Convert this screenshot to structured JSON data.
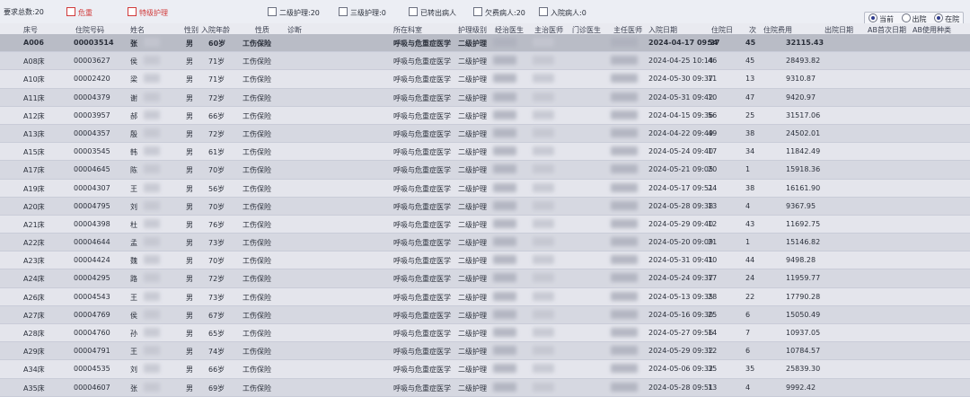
{
  "toolbar": {
    "count_label": "要求总数:20",
    "filter_red1": "危重",
    "filter_red2": "特级护理",
    "chk_level2": "二级护理:20",
    "chk_level3": "三级护理:0",
    "chk_transfer": "已转出病人",
    "chk_arrears": "欠费病人:20",
    "chk_preleave": "入院病人:0",
    "radio_all": "当前",
    "radio_out": "出院",
    "radio_cur": "在院"
  },
  "columns": {
    "bed": "床号",
    "inpatient_no": "住院号码",
    "name": "姓名",
    "sex": "性别",
    "age": "入院年龄",
    "nature": "性质",
    "diag": "诊断",
    "ward": "所在科室",
    "nurse_level": "护理级别",
    "doctor": "经治医生",
    "chief": "主治医师",
    "outpatient": "门诊医生",
    "dept_dir": "主任医师",
    "admit_date": "入院日期",
    "days": "住院日",
    "times": "次",
    "fee": "住院费用",
    "discharge": "出院日期",
    "ab_first": "AB首次日期",
    "ab_types": "AB使用种类"
  },
  "rows": [
    {
      "bed": "A006",
      "no": "00003514",
      "name": "张",
      "sex": "男",
      "age": "60岁",
      "nature": "工伤保险",
      "ward": "呼吸与危重症医学",
      "level": "二级护理",
      "date": "2024-04-17 09:27",
      "days": "54",
      "times": "45",
      "fee": "32115.43"
    },
    {
      "bed": "A08床",
      "no": "00003627",
      "name": "侯",
      "sex": "男",
      "age": "71岁",
      "nature": "工伤保险",
      "ward": "呼吸与危重症医学",
      "level": "二级护理",
      "date": "2024-04-25 10:14",
      "days": "46",
      "times": "45",
      "fee": "28493.82"
    },
    {
      "bed": "A10床",
      "no": "00002420",
      "name": "梁",
      "sex": "男",
      "age": "71岁",
      "nature": "工伤保险",
      "ward": "呼吸与危重症医学",
      "level": "二级护理",
      "date": "2024-05-30 09:37",
      "days": "11",
      "times": "13",
      "fee": "9310.87"
    },
    {
      "bed": "A11床",
      "no": "00004379",
      "name": "谢",
      "sex": "男",
      "age": "72岁",
      "nature": "工伤保险",
      "ward": "呼吸与危重症医学",
      "level": "二级护理",
      "date": "2024-05-31 09:42",
      "days": "10",
      "times": "47",
      "fee": "9420.97"
    },
    {
      "bed": "A12床",
      "no": "00003957",
      "name": "郝",
      "sex": "男",
      "age": "66岁",
      "nature": "工伤保险",
      "ward": "呼吸与危重症医学",
      "level": "二级护理",
      "date": "2024-04-15 09:36",
      "days": "56",
      "times": "25",
      "fee": "31517.06"
    },
    {
      "bed": "A13床",
      "no": "00004357",
      "name": "殷",
      "sex": "男",
      "age": "72岁",
      "nature": "工伤保险",
      "ward": "呼吸与危重症医学",
      "level": "二级护理",
      "date": "2024-04-22 09:49",
      "days": "49",
      "times": "38",
      "fee": "24502.01"
    },
    {
      "bed": "A15床",
      "no": "00003545",
      "name": "韩",
      "sex": "男",
      "age": "61岁",
      "nature": "工伤保险",
      "ward": "呼吸与危重症医学",
      "level": "二级护理",
      "date": "2024-05-24 09:40",
      "days": "17",
      "times": "34",
      "fee": "11842.49"
    },
    {
      "bed": "A17床",
      "no": "00004645",
      "name": "陈",
      "sex": "男",
      "age": "70岁",
      "nature": "工伤保险",
      "ward": "呼吸与危重症医学",
      "level": "二级护理",
      "date": "2024-05-21 09:05",
      "days": "20",
      "times": "1",
      "fee": "15918.36"
    },
    {
      "bed": "A19床",
      "no": "00004307",
      "name": "王",
      "sex": "男",
      "age": "56岁",
      "nature": "工伤保险",
      "ward": "呼吸与危重症医学",
      "level": "二级护理",
      "date": "2024-05-17 09:51",
      "days": "24",
      "times": "38",
      "fee": "16161.90"
    },
    {
      "bed": "A20床",
      "no": "00004795",
      "name": "刘",
      "sex": "男",
      "age": "70岁",
      "nature": "工伤保险",
      "ward": "呼吸与危重症医学",
      "level": "二级护理",
      "date": "2024-05-28 09:38",
      "days": "13",
      "times": "4",
      "fee": "9367.95"
    },
    {
      "bed": "A21床",
      "no": "00004398",
      "name": "杜",
      "sex": "男",
      "age": "76岁",
      "nature": "工伤保险",
      "ward": "呼吸与危重症医学",
      "level": "二级护理",
      "date": "2024-05-29 09:40",
      "days": "12",
      "times": "43",
      "fee": "11692.75"
    },
    {
      "bed": "A22床",
      "no": "00004644",
      "name": "孟",
      "sex": "男",
      "age": "73岁",
      "nature": "工伤保险",
      "ward": "呼吸与危重症医学",
      "level": "二级护理",
      "date": "2024-05-20 09:09",
      "days": "21",
      "times": "1",
      "fee": "15146.82"
    },
    {
      "bed": "A23床",
      "no": "00004424",
      "name": "魏",
      "sex": "男",
      "age": "70岁",
      "nature": "工伤保险",
      "ward": "呼吸与危重症医学",
      "level": "二级护理",
      "date": "2024-05-31 09:41",
      "days": "10",
      "times": "44",
      "fee": "9498.28"
    },
    {
      "bed": "A24床",
      "no": "00004295",
      "name": "路",
      "sex": "男",
      "age": "72岁",
      "nature": "工伤保险",
      "ward": "呼吸与危重症医学",
      "level": "二级护理",
      "date": "2024-05-24 09:37",
      "days": "17",
      "times": "24",
      "fee": "11959.77"
    },
    {
      "bed": "A26床",
      "no": "00004543",
      "name": "王",
      "sex": "男",
      "age": "73岁",
      "nature": "工伤保险",
      "ward": "呼吸与危重症医学",
      "level": "二级护理",
      "date": "2024-05-13 09:35",
      "days": "28",
      "times": "22",
      "fee": "17790.28"
    },
    {
      "bed": "A27床",
      "no": "00004769",
      "name": "侯",
      "sex": "男",
      "age": "67岁",
      "nature": "工伤保险",
      "ward": "呼吸与危重症医学",
      "level": "二级护理",
      "date": "2024-05-16 09:30",
      "days": "25",
      "times": "6",
      "fee": "15050.49"
    },
    {
      "bed": "A28床",
      "no": "00004760",
      "name": "孙",
      "sex": "男",
      "age": "65岁",
      "nature": "工伤保险",
      "ward": "呼吸与危重症医学",
      "level": "二级护理",
      "date": "2024-05-27 09:56",
      "days": "14",
      "times": "7",
      "fee": "10937.05"
    },
    {
      "bed": "A29床",
      "no": "00004791",
      "name": "王",
      "sex": "男",
      "age": "74岁",
      "nature": "工伤保险",
      "ward": "呼吸与危重症医学",
      "level": "二级护理",
      "date": "2024-05-29 09:32",
      "days": "12",
      "times": "6",
      "fee": "10784.57"
    },
    {
      "bed": "A34床",
      "no": "00004535",
      "name": "刘",
      "sex": "男",
      "age": "66岁",
      "nature": "工伤保险",
      "ward": "呼吸与危重症医学",
      "level": "二级护理",
      "date": "2024-05-06 09:32",
      "days": "35",
      "times": "35",
      "fee": "25839.30"
    },
    {
      "bed": "A35床",
      "no": "00004607",
      "name": "张",
      "sex": "男",
      "age": "69岁",
      "nature": "工伤保险",
      "ward": "呼吸与危重症医学",
      "level": "二级护理",
      "date": "2024-05-28 09:51",
      "days": "13",
      "times": "4",
      "fee": "9992.42"
    }
  ]
}
